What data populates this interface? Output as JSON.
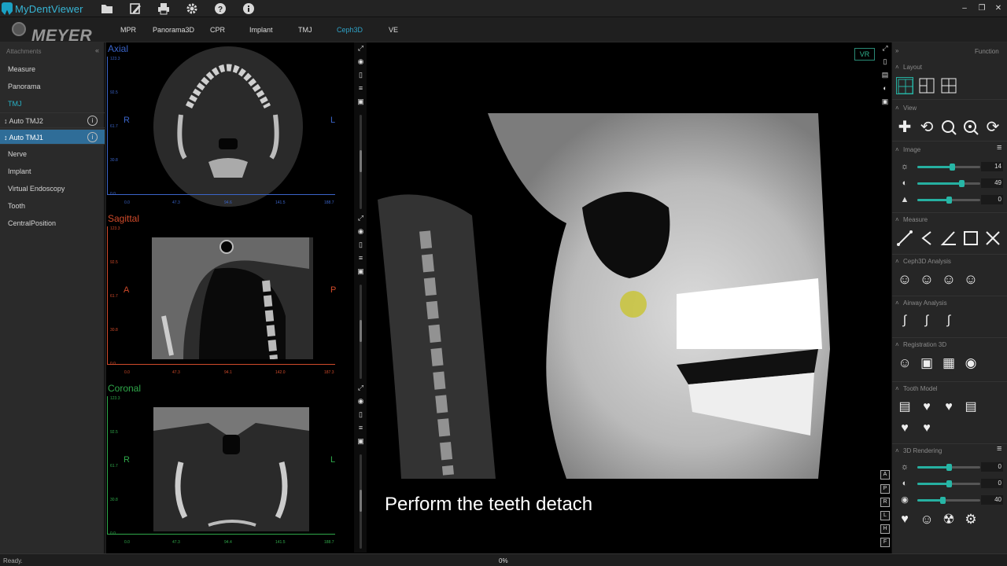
{
  "app": {
    "title": "MyDentViewer",
    "watermark": "MEYER"
  },
  "toolbar": {
    "icons": [
      "folder-icon",
      "edit-icon",
      "print-icon",
      "gear-icon",
      "help-icon",
      "info-icon"
    ],
    "window_controls": [
      "minimize-icon",
      "restore-icon",
      "close-icon"
    ]
  },
  "tabs": [
    {
      "label": "MPR"
    },
    {
      "label": "Panorama3D"
    },
    {
      "label": "CPR"
    },
    {
      "label": "Implant"
    },
    {
      "label": "TMJ"
    },
    {
      "label": "Ceph3D",
      "active": true
    },
    {
      "label": "VE"
    }
  ],
  "sidebar": {
    "header": "Attachments",
    "items": [
      {
        "label": "Measure"
      },
      {
        "label": "Panorama"
      },
      {
        "label": "TMJ",
        "active": true
      },
      {
        "label": "Auto TMJ2",
        "sub": true
      },
      {
        "label": "Auto TMJ1",
        "sub": true,
        "selected": true
      },
      {
        "label": "Nerve"
      },
      {
        "label": "Implant"
      },
      {
        "label": "Virtual Endoscopy"
      },
      {
        "label": "Tooth"
      },
      {
        "label": "CentralPosition"
      }
    ]
  },
  "viewports": [
    {
      "name": "Axial",
      "color": "#3a64c8",
      "left_label": "R",
      "right_label": "L",
      "v_ticks": [
        "123.3",
        "92.5",
        "61.7",
        "30.8",
        "0.0"
      ],
      "h_ticks": [
        "0.0",
        "47.3",
        "94.6",
        "141.5",
        "188.7"
      ]
    },
    {
      "name": "Sagittal",
      "color": "#d04a2a",
      "left_label": "A",
      "right_label": "P",
      "v_ticks": [
        "123.3",
        "92.5",
        "61.7",
        "30.8",
        "0.0"
      ],
      "h_ticks": [
        "0.0",
        "47.3",
        "94.1",
        "142.0",
        "187.3"
      ]
    },
    {
      "name": "Coronal",
      "color": "#2fa84a",
      "left_label": "R",
      "right_label": "L",
      "v_ticks": [
        "123.3",
        "92.5",
        "61.7",
        "30.8",
        "0.0"
      ],
      "h_ticks": [
        "0.0",
        "47.3",
        "94.4",
        "141.5",
        "188.7"
      ]
    }
  ],
  "main_view": {
    "mode_badge": "VR",
    "caption": "Perform the teeth detach"
  },
  "right_view_letters": [
    "A",
    "P",
    "R",
    "L",
    "H",
    "F"
  ],
  "function_panel": {
    "header": "Function",
    "sections": {
      "layout": "Layout",
      "view": "View",
      "image": "Image",
      "measure": "Measure",
      "ceph": "Ceph3D Analysis",
      "airway": "Airway Analysis",
      "registration": "Registration 3D",
      "tooth_model": "Tooth Model",
      "rendering": "3D Rendering"
    },
    "image_sliders": [
      {
        "icon": "brightness-icon",
        "value": "14",
        "level": 0.55
      },
      {
        "icon": "contrast-icon",
        "value": "49",
        "level": 0.7
      },
      {
        "icon": "sharpen-icon",
        "value": "0",
        "level": 0.5
      }
    ],
    "render_sliders": [
      {
        "icon": "brightness-icon",
        "value": "0",
        "level": 0.5
      },
      {
        "icon": "contrast-icon",
        "value": "0",
        "level": 0.5
      },
      {
        "icon": "opacity-icon",
        "value": "40",
        "level": 0.4
      }
    ]
  },
  "status": {
    "left": "Ready.",
    "center": "0%"
  }
}
